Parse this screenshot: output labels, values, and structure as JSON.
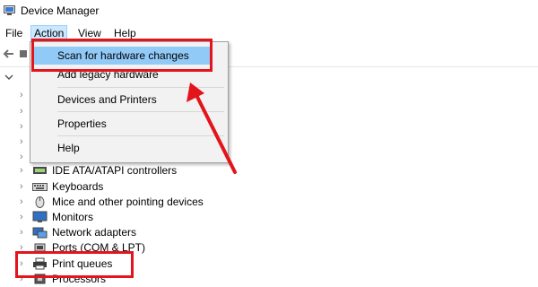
{
  "window": {
    "title": "Device Manager"
  },
  "menubar": {
    "items": [
      "File",
      "Action",
      "View",
      "Help"
    ]
  },
  "dropdown": {
    "items": [
      "Scan for hardware changes",
      "Add legacy hardware",
      "Devices and Printers",
      "Properties",
      "Help"
    ]
  },
  "tree": {
    "items": [
      {
        "label": "IDE ATA/ATAPI controllers",
        "icon": "ide-controller-icon"
      },
      {
        "label": "Keyboards",
        "icon": "keyboard-icon"
      },
      {
        "label": "Mice and other pointing devices",
        "icon": "mouse-icon"
      },
      {
        "label": "Monitors",
        "icon": "monitor-icon"
      },
      {
        "label": "Network adapters",
        "icon": "network-adapter-icon"
      },
      {
        "label": "Ports (COM & LPT)",
        "icon": "port-icon"
      },
      {
        "label": "Print queues",
        "icon": "printer-icon"
      },
      {
        "label": "Processors",
        "icon": "processor-icon"
      }
    ]
  },
  "colors": {
    "highlight": "#91c9f7",
    "annotation": "#e3141b"
  }
}
